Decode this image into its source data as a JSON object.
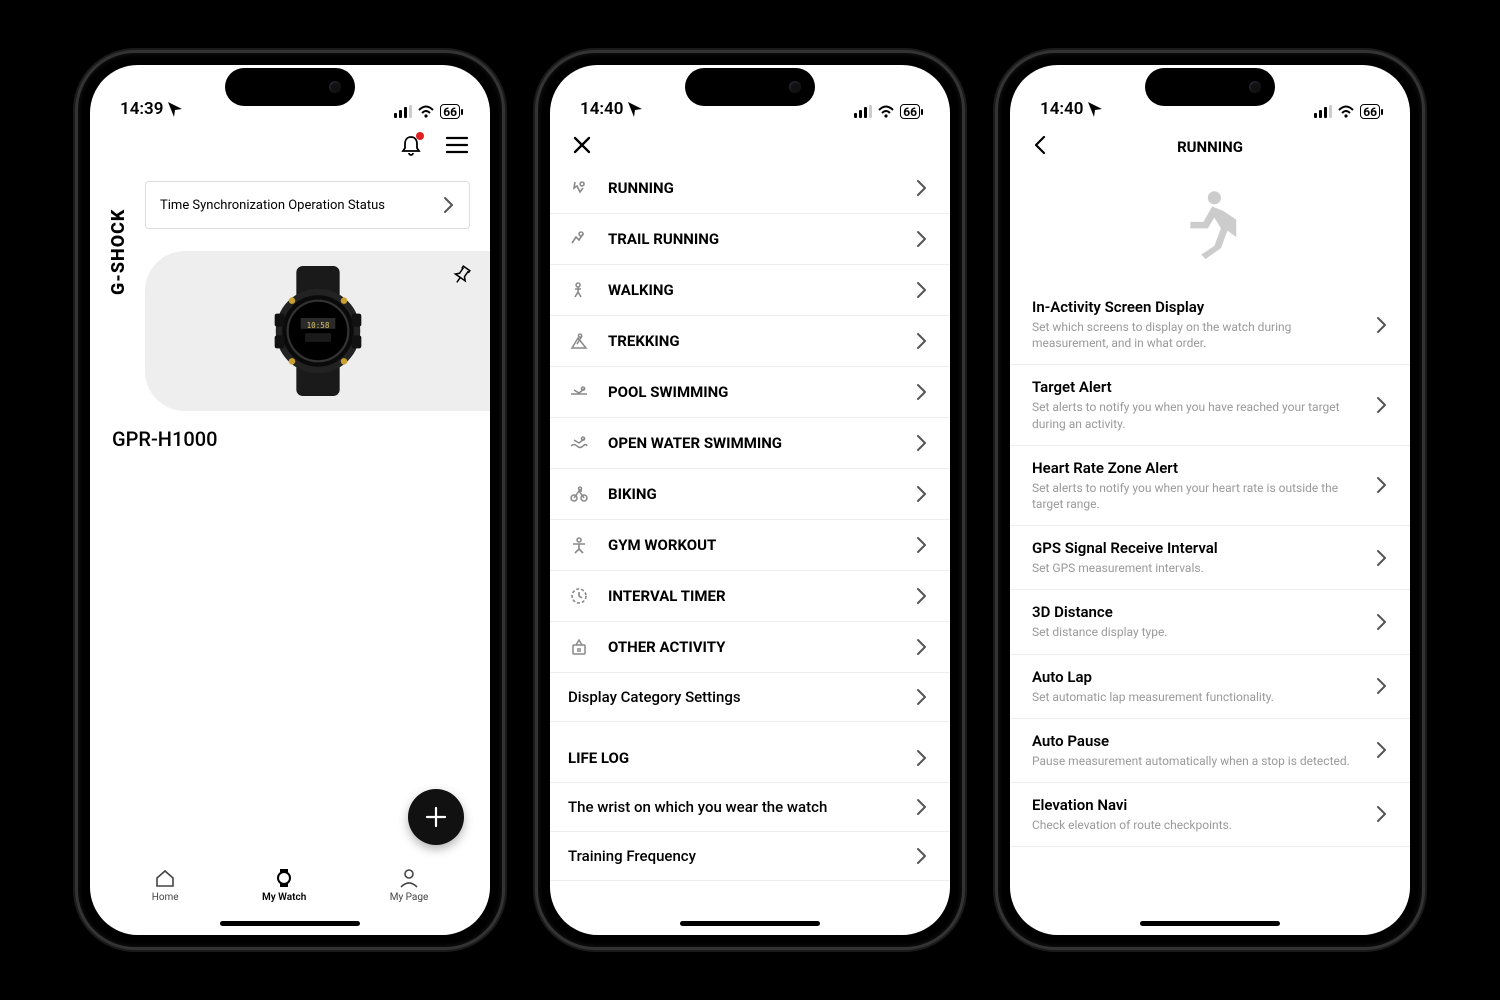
{
  "status": {
    "battery": "66"
  },
  "times": {
    "s1": "14:39",
    "s2": "14:40",
    "s3": "14:40"
  },
  "screen1": {
    "brand": "G-SHOCK",
    "sync_label": "Time Synchronization Operation Status",
    "model": "GPR-H1000",
    "nav": {
      "home": "Home",
      "watch": "My Watch",
      "page": "My Page"
    }
  },
  "screen2": {
    "activities": [
      "RUNNING",
      "TRAIL RUNNING",
      "WALKING",
      "TREKKING",
      "POOL SWIMMING",
      "OPEN WATER SWIMMING",
      "BIKING",
      "GYM WORKOUT",
      "INTERVAL TIMER",
      "OTHER ACTIVITY"
    ],
    "display_cat": "Display Category Settings",
    "life_log": "LIFE LOG",
    "wrist": "The wrist on which you wear the watch",
    "training_freq": "Training Frequency"
  },
  "screen3": {
    "title": "RUNNING",
    "items": [
      {
        "t": "In-Activity Screen Display",
        "d": "Set which screens to display on the watch during measurement, and in what order."
      },
      {
        "t": "Target Alert",
        "d": "Set alerts to notify you when you have reached your target during an activity."
      },
      {
        "t": "Heart Rate Zone Alert",
        "d": "Set alerts to notify you when your heart rate is outside the target range."
      },
      {
        "t": "GPS Signal Receive Interval",
        "d": "Set GPS measurement intervals."
      },
      {
        "t": "3D Distance",
        "d": "Set distance display type."
      },
      {
        "t": "Auto Lap",
        "d": "Set automatic lap measurement functionality."
      },
      {
        "t": "Auto Pause",
        "d": "Pause measurement automatically when a stop is detected."
      },
      {
        "t": "Elevation Navi",
        "d": "Check elevation of route checkpoints."
      }
    ]
  }
}
